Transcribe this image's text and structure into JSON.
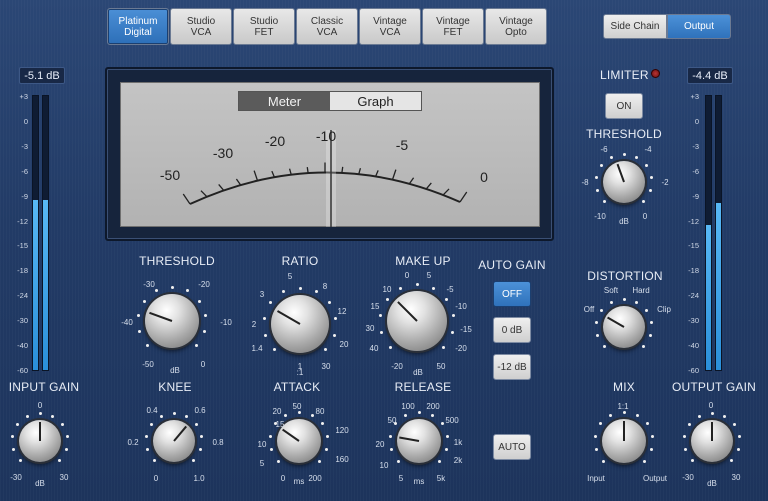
{
  "models": [
    {
      "label": "Platinum\nDigital",
      "active": true
    },
    {
      "label": "Studio\nVCA",
      "active": false
    },
    {
      "label": "Studio\nFET",
      "active": false
    },
    {
      "label": "Classic\nVCA",
      "active": false
    },
    {
      "label": "Vintage\nVCA",
      "active": false
    },
    {
      "label": "Vintage\nFET",
      "active": false
    },
    {
      "label": "Vintage\nOpto",
      "active": false
    }
  ],
  "routing": {
    "side_chain": "Side Chain",
    "output": "Output"
  },
  "input": {
    "readout": "-5.1 dB",
    "meter_level": 0.62,
    "label": "INPUT GAIN",
    "scale": [
      "+3",
      "0",
      "-3",
      "-6",
      "-9",
      "-12",
      "-15",
      "-18",
      "-24",
      "-30",
      "-40",
      "-60"
    ],
    "knob": {
      "top": "0",
      "left": "-30",
      "right": "30",
      "unit": "dB"
    }
  },
  "output": {
    "readout": "-4.4 dB",
    "meter_levels": [
      0.53,
      0.61
    ],
    "label": "OUTPUT GAIN",
    "scale": [
      "+3",
      "0",
      "-3",
      "-6",
      "-9",
      "-12",
      "-15",
      "-18",
      "-24",
      "-30",
      "-40",
      "-60"
    ],
    "knob": {
      "top": "0",
      "left": "-30",
      "right": "30",
      "unit": "dB"
    }
  },
  "vu": {
    "tab_meter": "Meter",
    "tab_graph": "Graph",
    "scale": [
      "-50",
      "-30",
      "-20",
      "-10",
      "-5",
      "0"
    ]
  },
  "limiter": {
    "label": "LIMITER",
    "button": "ON",
    "threshold_label": "THRESHOLD",
    "ticks": [
      "-6",
      "-4",
      "-8",
      "-2",
      "-10",
      "0"
    ],
    "unit": "dB"
  },
  "distortion": {
    "label": "DISTORTION",
    "soft": "Soft",
    "hard": "Hard",
    "off": "Off",
    "clip": "Clip"
  },
  "mix": {
    "label": "MIX",
    "top": "1:1",
    "left": "Input",
    "right": "Output"
  },
  "threshold": {
    "label": "THRESHOLD",
    "ticks": [
      "-30",
      "-20",
      "-40",
      "-10",
      "-50",
      "0"
    ],
    "unit": "dB"
  },
  "ratio": {
    "label": "RATIO",
    "ticks": [
      "5",
      "3",
      "8",
      "2",
      "12",
      "1.4",
      "20",
      "1",
      "30"
    ],
    "unit": ":1"
  },
  "makeup": {
    "label": "MAKE UP",
    "ticks": [
      "0",
      "5",
      "10",
      "-5",
      "15",
      "-10",
      "30",
      "-15",
      "40",
      "-20",
      "50",
      "20"
    ],
    "unit": "dB"
  },
  "auto_gain": {
    "label": "AUTO GAIN",
    "off": "OFF",
    "zero": "0 dB",
    "minus12": "-12 dB"
  },
  "knee": {
    "label": "KNEE",
    "ticks": [
      "0.4",
      "0.6",
      "0.2",
      "0.8",
      "0",
      "1.0"
    ]
  },
  "attack": {
    "label": "ATTACK",
    "ticks": [
      "20",
      "50",
      "10",
      "80",
      "15",
      "120",
      "10",
      "160",
      "5",
      "0",
      "200"
    ],
    "unit": "ms"
  },
  "release": {
    "label": "RELEASE",
    "ticks": [
      "100",
      "200",
      "50",
      "500",
      "20",
      "1k",
      "10",
      "2k",
      "5",
      "5k"
    ],
    "unit": "ms",
    "auto": "AUTO"
  }
}
